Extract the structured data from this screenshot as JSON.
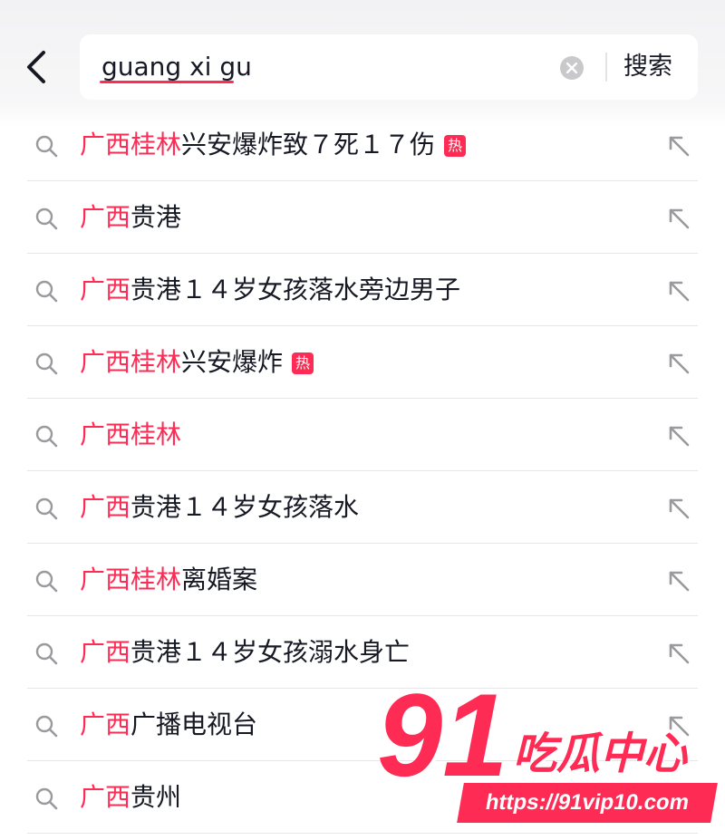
{
  "header": {
    "query": "guang xi gu",
    "search_label": "搜索"
  },
  "suggestions": [
    {
      "highlight": "广西桂林",
      "rest": "兴安爆炸致７死１７伤",
      "hot": true
    },
    {
      "highlight": "广西",
      "rest": "贵港",
      "hot": false
    },
    {
      "highlight": "广西",
      "rest": "贵港１４岁女孩落水旁边男子",
      "hot": false
    },
    {
      "highlight": "广西桂林",
      "rest": "兴安爆炸",
      "hot": true
    },
    {
      "highlight": "广西桂林",
      "rest": "",
      "hot": false
    },
    {
      "highlight": "广西",
      "rest": "贵港１４岁女孩落水",
      "hot": false
    },
    {
      "highlight": "广西桂林",
      "rest": "离婚案",
      "hot": false
    },
    {
      "highlight": "广西",
      "rest": "贵港１４岁女孩溺水身亡",
      "hot": false
    },
    {
      "highlight": "广西",
      "rest": "广播电视台",
      "hot": false
    },
    {
      "highlight": "广西",
      "rest": "贵州",
      "hot": false
    }
  ],
  "hot_badge_label": "热",
  "watermark": {
    "number": "91",
    "name": "吃瓜中心",
    "url": "https://91vip10.com"
  },
  "colors": {
    "accent": "#fe2c55",
    "text": "#161823",
    "icon_gray": "#9a9a9e"
  },
  "icons": {
    "back": "chevron-left-icon",
    "clear": "clear-circle-icon",
    "suggestion": "search-icon",
    "fill": "arrow-up-left-icon"
  }
}
